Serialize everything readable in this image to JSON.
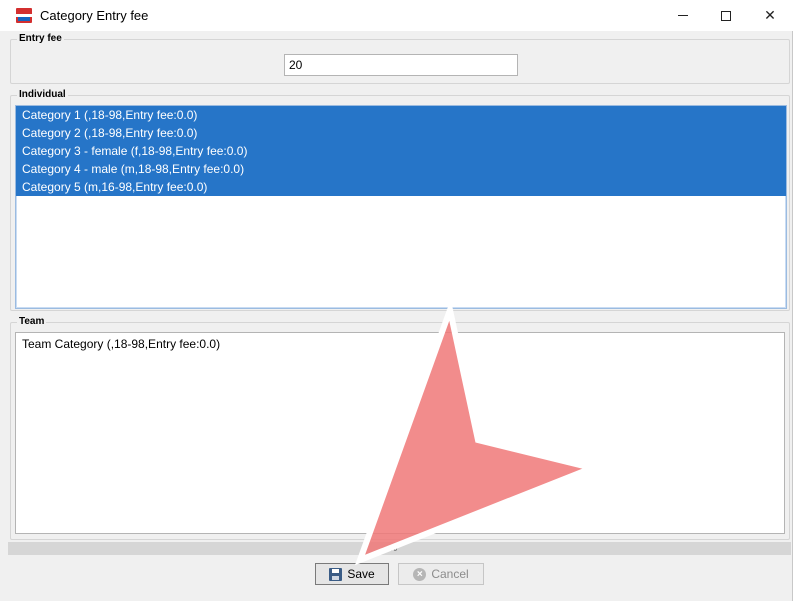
{
  "window": {
    "title": "Category Entry fee"
  },
  "entry_fee": {
    "legend": "Entry fee",
    "value": "20"
  },
  "individual": {
    "legend": "Individual",
    "items": [
      "Category 1 (,18-98,Entry fee:0.0)",
      "Category 2 (,18-98,Entry fee:0.0)",
      "Category 3 - female (f,18-98,Entry fee:0.0)",
      "Category 4 - male (m,18-98,Entry fee:0.0)",
      "Category 5 (m,16-98,Entry fee:0.0)"
    ]
  },
  "team": {
    "legend": "Team",
    "items": [
      "Team Category (,18-98,Entry fee:0.0)"
    ]
  },
  "status": {
    "text": "%"
  },
  "buttons": {
    "save": "Save",
    "cancel": "Cancel"
  },
  "colors": {
    "selection": "#2675c8",
    "pointer_overlay": "#f07878"
  },
  "icons": {
    "app": "app-flag-icon",
    "save": "floppy-disk-icon",
    "cancel": "cancel-circle-icon"
  }
}
